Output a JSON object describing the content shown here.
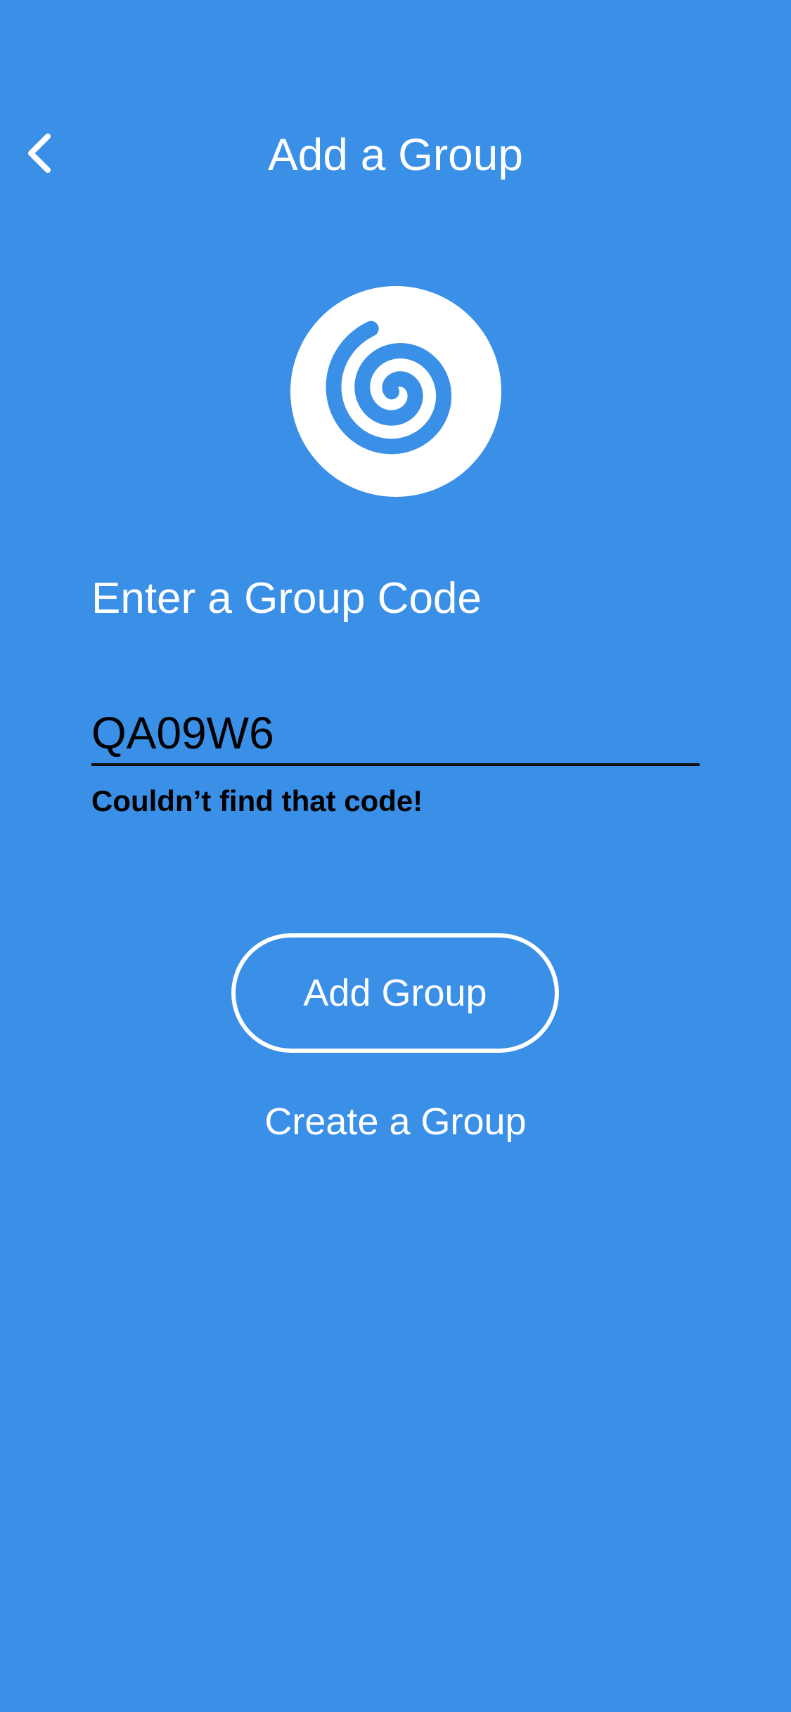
{
  "header": {
    "title": "Add a Group",
    "back_icon": "chevron-left-icon"
  },
  "logo": {
    "icon": "spiral-icon",
    "background_color": "#ffffff",
    "icon_color": "#3a8fe7"
  },
  "form": {
    "heading": "Enter a Group Code",
    "code_value": "QA09W6",
    "error_message": "Couldn’t find that code!"
  },
  "actions": {
    "add_group_label": "Add Group",
    "create_group_label": "Create a Group"
  },
  "colors": {
    "background": "#3a8fe7",
    "foreground": "#ffffff",
    "error": "#000000"
  }
}
